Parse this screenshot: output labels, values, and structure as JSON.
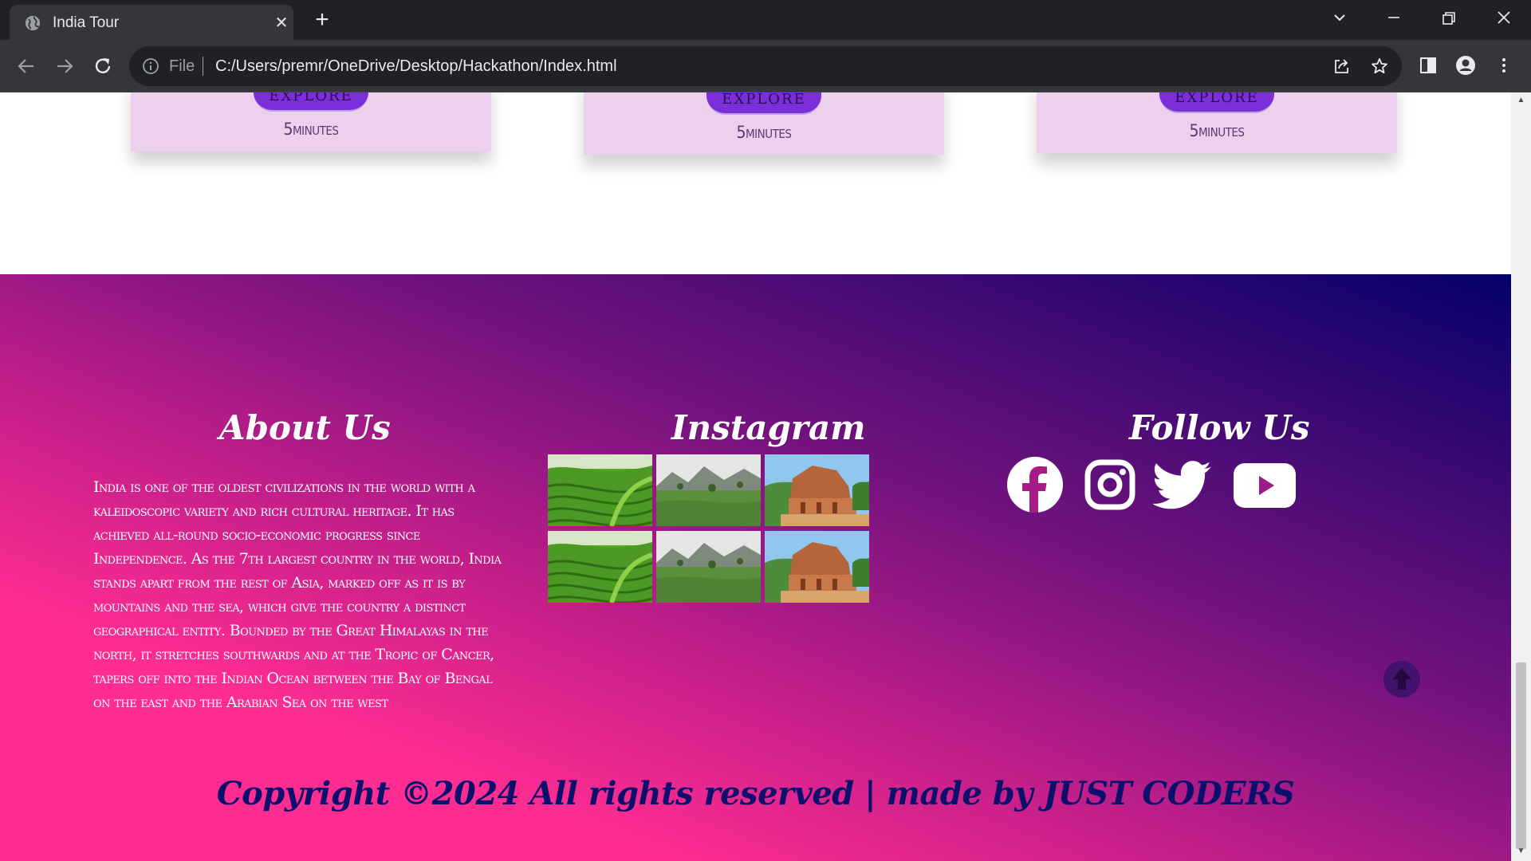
{
  "browser": {
    "tab_title": "India Tour",
    "tab_close": "✕",
    "new_tab": "+",
    "url_scheme": "File",
    "url": "C:/Users/premr/OneDrive/Desktop/Hackathon/Index.html",
    "icons": [
      "globe-icon",
      "back-arrow-icon",
      "forward-arrow-icon",
      "reload-icon",
      "info-icon",
      "share-icon",
      "star-icon",
      "side-panel-icon",
      "profile-icon",
      "menu-dots-icon",
      "tab-search-icon",
      "minimize-icon",
      "restore-icon",
      "close-icon"
    ]
  },
  "cards": [
    {
      "button_label": "EXPLORE",
      "time": "5minutes"
    },
    {
      "button_label": "EXPLORE",
      "time": "5minutes"
    },
    {
      "button_label": "EXPLORE",
      "time": "5minutes"
    }
  ],
  "footer": {
    "about": {
      "title": "About Us",
      "text": "India is one of the oldest civilizations in the world with a kaleidoscopic variety and rich cultural heritage. It has achieved all-round socio-economic progress since Independence. As the 7th largest country in the world, India stands apart from the rest of Asia, marked off as it is by mountains and the sea, which give the country a distinct geographical entity. Bounded by the Great Himalayas in the north, it stretches southwards and at the Tropic of Cancer, tapers off into the Indian Ocean between the Bay of Bengal on the east and the Arabian Sea on the west"
    },
    "instagram": {
      "title": "Instagram",
      "images": [
        "tea-plantation-photo",
        "misty-hills-photo",
        "temple-ruins-photo",
        "tea-plantation-photo",
        "misty-hills-photo",
        "temple-ruins-photo"
      ]
    },
    "follow": {
      "title": "Follow Us",
      "icons": [
        "facebook-icon",
        "instagram-icon",
        "twitter-icon",
        "youtube-icon"
      ]
    },
    "copyright": "Copyright ©2024 All rights reserved | made by JUST CODERS"
  },
  "colors": {
    "footer_gradient_start": "#ff2d92",
    "footer_gradient_end": "#05016a",
    "card_bg": "#ecd0ed",
    "explore_button": "#7a2fd8",
    "copyright_text": "#0c0f6c"
  }
}
